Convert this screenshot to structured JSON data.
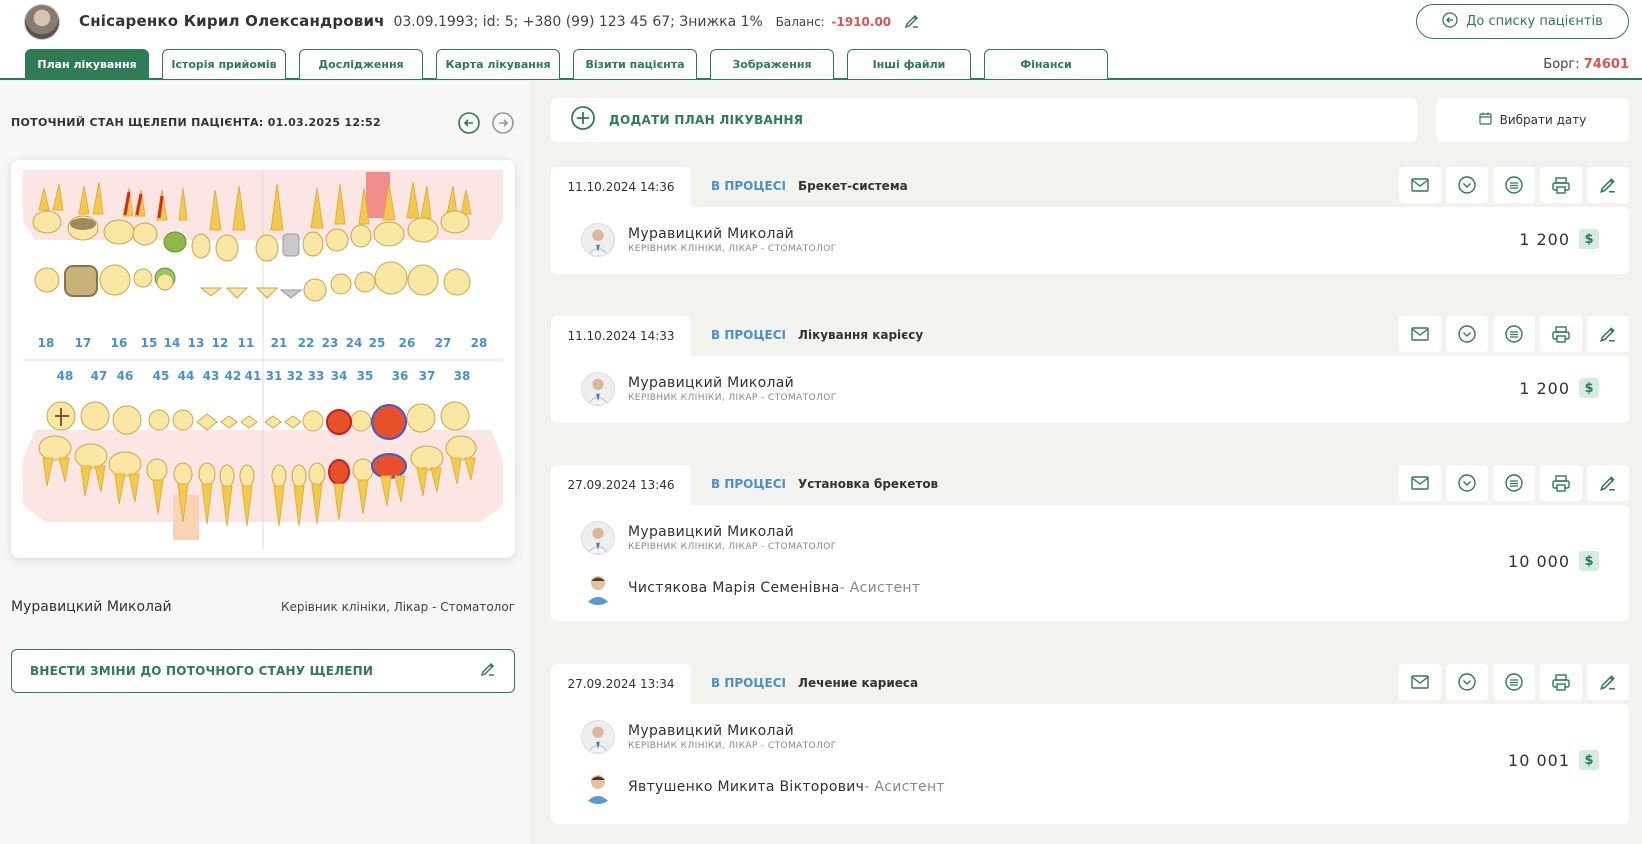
{
  "header": {
    "patient_name": "Снісаренко Кирил Олександрович",
    "patient_meta": "03.09.1993; id: 5; +380 (99) 123 45 67; Знижка 1%",
    "balance_label": "Баланс:",
    "balance_value": "-1910.00",
    "back_button": "До списку пацієнтів",
    "debt_label": "Борг:",
    "debt_value": "74601"
  },
  "tabs": [
    {
      "label": "План лікування",
      "active": true
    },
    {
      "label": "Історія прийомів"
    },
    {
      "label": "Дослідження"
    },
    {
      "label": "Карта лікування"
    },
    {
      "label": "Візити пацієнта"
    },
    {
      "label": "Зображення"
    },
    {
      "label": "Інші файли"
    },
    {
      "label": "Фінанси"
    }
  ],
  "jaw": {
    "title": "ПОТОЧНИЙ СТАН ЩЕЛЕПИ ПАЦІЄНТА: 01.03.2025 12:52",
    "upper_numbers": [
      "18",
      "17",
      "16",
      "15",
      "14",
      "13",
      "12",
      "11",
      "21",
      "22",
      "23",
      "24",
      "25",
      "26",
      "27",
      "28"
    ],
    "lower_numbers": [
      "48",
      "47",
      "46",
      "45",
      "44",
      "43",
      "42",
      "41",
      "31",
      "32",
      "33",
      "34",
      "35",
      "36",
      "37",
      "38"
    ],
    "doctor_name": "Муравицкий Миколай",
    "doctor_role": "Керівник клініки, Лікар - Стоматолог",
    "change_button": "ВНЕСТИ ЗМІНИ ДО ПОТОЧНОГО СТАНУ ЩЕЛЕПИ"
  },
  "actions": {
    "add_plan": "ДОДАТИ ПЛАН ЛІКУВАННЯ",
    "choose_date": "Вибрати дату"
  },
  "plans": [
    {
      "date": "11.10.2024 14:36",
      "status": "В ПРОЦЕСІ",
      "title": "Брекет-система",
      "doctor": "Муравицкий Миколай",
      "doctor_role": "КЕРІВНИК КЛІНІКИ, ЛІКАР - СТОМАТОЛОГ",
      "price": "1 200"
    },
    {
      "date": "11.10.2024 14:33",
      "status": "В ПРОЦЕСІ",
      "title": "Лікування карієсу",
      "doctor": "Муравицкий Миколай",
      "doctor_role": "КЕРІВНИК КЛІНІКИ, ЛІКАР - СТОМАТОЛОГ",
      "price": "1 200"
    },
    {
      "date": "27.09.2024 13:46",
      "status": "В ПРОЦЕСІ",
      "title": "Установка брекетов",
      "doctor": "Муравицкий Миколай",
      "doctor_role": "КЕРІВНИК КЛІНІКИ, ЛІКАР - СТОМАТОЛОГ",
      "assistant": "Чистякова Марія Семенівна",
      "assistant_role": " - Асистент",
      "price": "10 000"
    },
    {
      "date": "27.09.2024 13:34",
      "status": "В ПРОЦЕСІ",
      "title": "Лечение кариеса",
      "doctor": "Муравицкий Миколай",
      "doctor_role": "КЕРІВНИК КЛІНІКИ, ЛІКАР - СТОМАТОЛОГ",
      "assistant": "Явтушенко Микита Вікторович",
      "assistant_role": " - Асистент",
      "price": "10 001"
    }
  ],
  "currency_symbol": "$",
  "colors": {
    "accent": "#2f7a57",
    "status": "#4a90c9",
    "negative": "#d9534f",
    "tooth": "#f5d97a",
    "caries": "#e8502a"
  }
}
